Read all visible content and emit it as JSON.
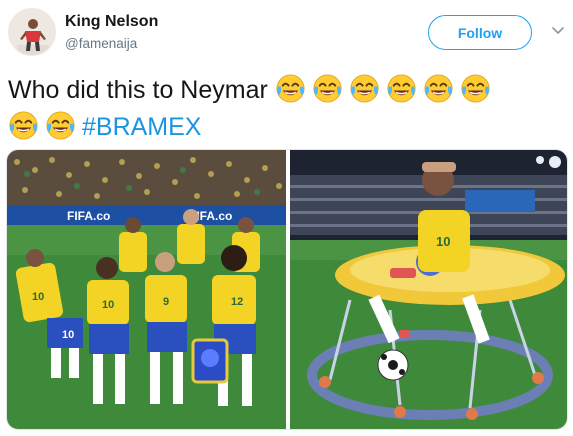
{
  "author": {
    "display_name": "King Nelson",
    "handle": "@famenaija"
  },
  "follow_button": {
    "label": "Follow"
  },
  "tweet": {
    "text": "Who did this to  Neymar",
    "hashtag": "#BRAMEX",
    "emoji": "face-with-tears-of-joy",
    "emoji_count_line1": 6,
    "emoji_count_line2": 2
  },
  "media": {
    "left_photo": {
      "banner_text_1": "FIFA.co",
      "banner_text_2": "FIFA.co",
      "jersey_numbers": [
        "10",
        "10",
        "9",
        "12",
        "10"
      ]
    },
    "right_photo": {
      "jersey_number": "10"
    }
  },
  "colors": {
    "brand_blue": "#1da1f2",
    "hashtag_blue": "#1b95e0",
    "text_dark": "#14171a",
    "text_muted": "#657786",
    "jersey_yellow": "#f3d324",
    "shorts_blue": "#2a4fbf",
    "pitch_green": "#3f8a3a"
  }
}
